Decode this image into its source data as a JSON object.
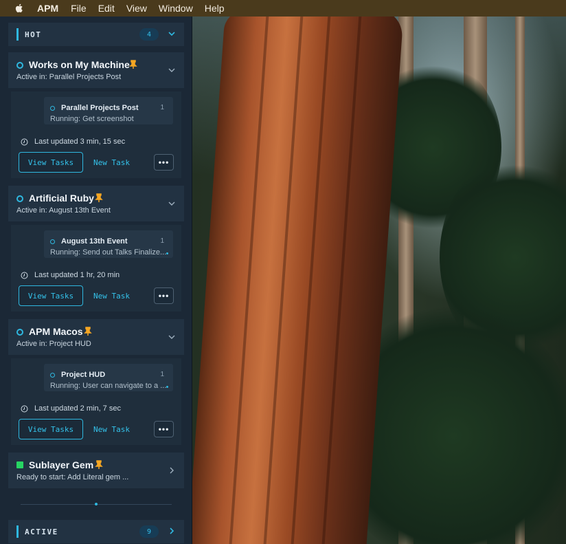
{
  "menubar": {
    "app_name": "APM",
    "items": [
      "File",
      "Edit",
      "View",
      "Window",
      "Help"
    ]
  },
  "sections": {
    "hot": {
      "title": "HOT",
      "count": "4"
    },
    "active": {
      "title": "ACTIVE",
      "count": "9"
    }
  },
  "projects": [
    {
      "name": "Works on My Machine",
      "subtitle": "Active in: Parallel Projects Post",
      "pinned": true,
      "status_icon": "circle-outline",
      "task": {
        "name": "Parallel Projects Post",
        "number": "1",
        "status": "Running: Get screenshot"
      },
      "updated": "Last updated 3 min, 15 sec",
      "view_tasks": "View Tasks",
      "new_task": "New Task",
      "more": "•••"
    },
    {
      "name": "Artificial Ruby",
      "subtitle": "Active in: August 13th Event",
      "pinned": true,
      "status_icon": "circle-outline",
      "task": {
        "name": "August 13th Event",
        "number": "1",
        "status": "Running: Send out Talks Finalize..."
      },
      "updated": "Last updated 1 hr, 20 min",
      "view_tasks": "View Tasks",
      "new_task": "New Task",
      "more": "•••"
    },
    {
      "name": "APM Macos",
      "subtitle": "Active in: Project HUD",
      "pinned": true,
      "status_icon": "circle-outline",
      "task": {
        "name": "Project HUD",
        "number": "1",
        "status": "Running: User can navigate to a ..."
      },
      "updated": "Last updated 2 min, 7 sec",
      "view_tasks": "View Tasks",
      "new_task": "New Task",
      "more": "•••"
    },
    {
      "name": "Sublayer Gem",
      "subtitle": "Ready to start: Add Literal gem ...",
      "pinned": true,
      "status_icon": "square-green"
    }
  ],
  "colors": {
    "accent": "#2fb8e0",
    "pin": "#f5a623",
    "ready": "#27d463",
    "menubar": "#4a3a1c",
    "sidebar": "#1b2836"
  }
}
